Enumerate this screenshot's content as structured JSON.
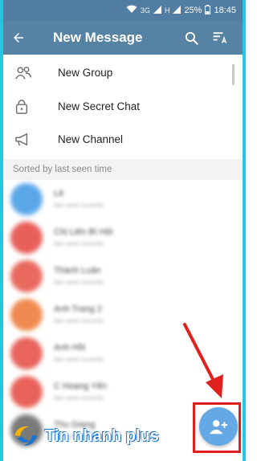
{
  "status_bar": {
    "battery": "25%",
    "time": "18:45",
    "network_1": "3G",
    "network_2": "H"
  },
  "app_bar": {
    "title": "New Message",
    "back_icon": "arrow-back-icon",
    "search_icon": "search-icon",
    "sort_icon": "sort-icon"
  },
  "menu": [
    {
      "label": "New Group",
      "icon": "group-icon"
    },
    {
      "label": "New Secret Chat",
      "icon": "lock-icon"
    },
    {
      "label": "New Channel",
      "icon": "megaphone-icon"
    }
  ],
  "section_header": "Sorted by last seen time",
  "contacts": [
    {
      "name": "Lê",
      "status": "last seen recently",
      "color": "#5aa7e8"
    },
    {
      "name": "Chị Liên Bì Hội",
      "status": "last seen recently",
      "color": "#e8605a"
    },
    {
      "name": "Thành Luân",
      "status": "last seen recently",
      "color": "#e86a5f"
    },
    {
      "name": "Anh Trang 2",
      "status": "last seen recently",
      "color": "#f08a52"
    },
    {
      "name": "Anh Hồi",
      "status": "last seen recently",
      "color": "#e8645c"
    },
    {
      "name": "C Hoang Yến",
      "status": "last seen recently",
      "color": "#e8625a"
    },
    {
      "name": "Thu Giang",
      "status": "last seen recently",
      "color": "#7a7a7a"
    }
  ],
  "fab": {
    "icon": "add-contact-icon",
    "color": "#64a9e6"
  },
  "annotation": {
    "color": "#e0201c"
  },
  "watermark": {
    "text": "Tin nhanh plus"
  }
}
